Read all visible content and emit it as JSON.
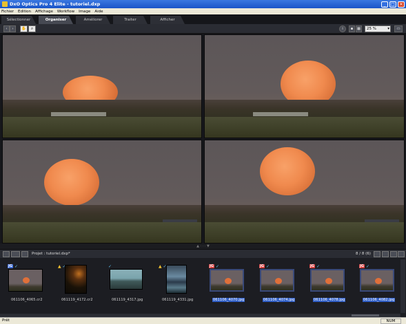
{
  "window": {
    "title": "DxO Optics Pro 4 Elite - tutoriel.dxp",
    "minimize": "_",
    "maximize": "□",
    "close": "✕"
  },
  "menu": [
    "Fichier",
    "Edition",
    "Affichage",
    "Workflow",
    "Image",
    "Aide"
  ],
  "tabs": [
    {
      "label": "Sélectionner",
      "active": false
    },
    {
      "label": "Organiser",
      "active": true
    },
    {
      "label": "Améliorer",
      "active": false
    },
    {
      "label": "Traiter",
      "active": false
    },
    {
      "label": "Afficher",
      "active": false
    }
  ],
  "toolbar": {
    "zoom": "25 %",
    "icons": [
      "back-arrow-icon",
      "forward-arrow-icon",
      "hand-icon",
      "magnifier-icon",
      "info-icon",
      "single-view-icon",
      "compare-view-icon",
      "fullscreen-icon"
    ]
  },
  "viewer": {
    "splitter": "▲ · · · ▼"
  },
  "project": {
    "label": "Projet :",
    "name": "tutoriel.dxp*",
    "count": "8 / 8 (6)"
  },
  "thumbnails": [
    {
      "name": "061106_4065.cr2",
      "badge": "JG",
      "badge_color": "#3a6ad8",
      "warn": false,
      "check": true,
      "selected": false,
      "kind": "moon"
    },
    {
      "name": "061119_4172.cr2",
      "badge": "",
      "badge_color": "",
      "warn": true,
      "check": true,
      "selected": false,
      "kind": "dark"
    },
    {
      "name": "061119_4317.jpg",
      "badge": "",
      "badge_color": "",
      "warn": false,
      "check": true,
      "selected": false,
      "kind": "sea"
    },
    {
      "name": "061119_4331.jpg",
      "badge": "",
      "badge_color": "",
      "warn": true,
      "check": true,
      "selected": false,
      "kind": "lake"
    },
    {
      "name": "061106_4070.jpg",
      "badge": "JG",
      "badge_color": "#d84040",
      "warn": false,
      "check": true,
      "selected": true,
      "kind": "moon"
    },
    {
      "name": "061106_4074.jpg",
      "badge": "JG",
      "badge_color": "#d84040",
      "warn": false,
      "check": true,
      "selected": true,
      "kind": "moon"
    },
    {
      "name": "061106_4078.jpg",
      "badge": "JG",
      "badge_color": "#d84040",
      "warn": false,
      "check": true,
      "selected": true,
      "kind": "moon"
    },
    {
      "name": "061106_4082.jpg",
      "badge": "JG",
      "badge_color": "#d84040",
      "warn": false,
      "check": true,
      "selected": true,
      "kind": "moon"
    }
  ],
  "status": {
    "left": "Prêt",
    "num": "NUM"
  }
}
